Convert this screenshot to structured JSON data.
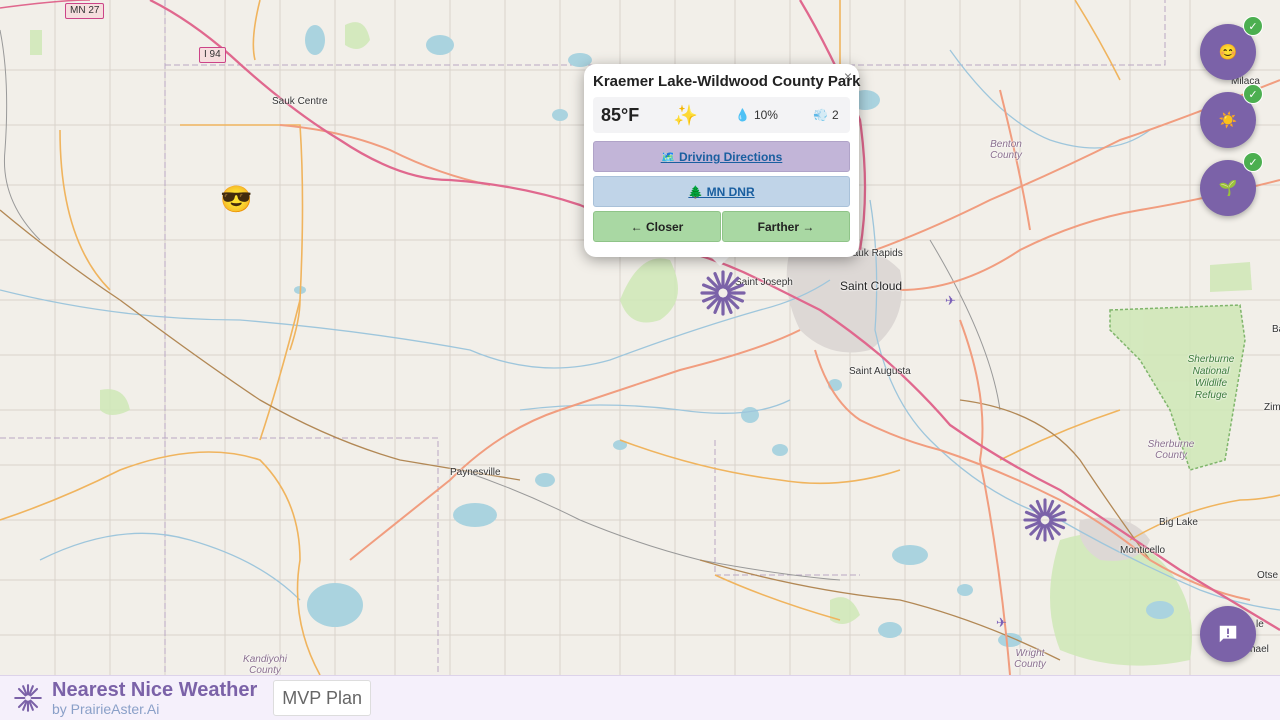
{
  "map": {
    "places": [
      {
        "id": "sauk-centre",
        "label": "Sauk Centre"
      },
      {
        "id": "saint-joseph",
        "label": "Saint Joseph"
      },
      {
        "id": "saint-cloud",
        "label": "Saint Cloud"
      },
      {
        "id": "sauk-rapids",
        "label": "Sauk Rapids"
      },
      {
        "id": "saint-augusta",
        "label": "Saint Augusta"
      },
      {
        "id": "paynesville",
        "label": "Paynesville"
      },
      {
        "id": "big-lake",
        "label": "Big Lake"
      },
      {
        "id": "monticello",
        "label": "Monticello"
      },
      {
        "id": "milaca",
        "label": "Milaca"
      },
      {
        "id": "zim",
        "label": "Zim"
      },
      {
        "id": "otse",
        "label": "Otse"
      },
      {
        "id": "ba",
        "label": "Ba"
      },
      {
        "id": "nael",
        "label": "nael"
      },
      {
        "id": "le",
        "label": "le"
      }
    ],
    "regions": {
      "benton": "Benton County",
      "sherburne": "Sherburne County",
      "wright": "Wright County",
      "kandiyohi": "Kandiyohi County",
      "refuge": "Sherburne National Wildlife Refuge"
    },
    "shields": {
      "i94": "I 94",
      "mn27": "MN 27"
    }
  },
  "popup": {
    "title": "Kraemer Lake-Wildwood County Park",
    "close": "×",
    "temperature": "85°F",
    "condition_icon": "sparkles",
    "condition_glyph": "✨",
    "precip_icon": "💧",
    "precip": "10%",
    "wind_icon": "💨",
    "wind": "2",
    "directions_label": "🗺️ Driving Directions",
    "dnr_label": "🌲 MN DNR",
    "closer_label": "← Closer",
    "farther_label": "Farther →"
  },
  "fabs": [
    {
      "name": "mood-filter",
      "glyph": "😊",
      "checked": "✓"
    },
    {
      "name": "weather-filter",
      "glyph": "☀️",
      "checked": "✓"
    },
    {
      "name": "season-filter",
      "glyph": "🌱",
      "checked": "✓"
    }
  ],
  "markers": {
    "user_location": "😎"
  },
  "footer": {
    "title": "Nearest Nice Weather",
    "subtitle": "by PrairieAster.Ai",
    "mvp_button": "MVP Plan"
  },
  "colors": {
    "brand_purple": "#7b62a8",
    "check_green": "#4caf50",
    "map_background": "#f2efe9"
  }
}
